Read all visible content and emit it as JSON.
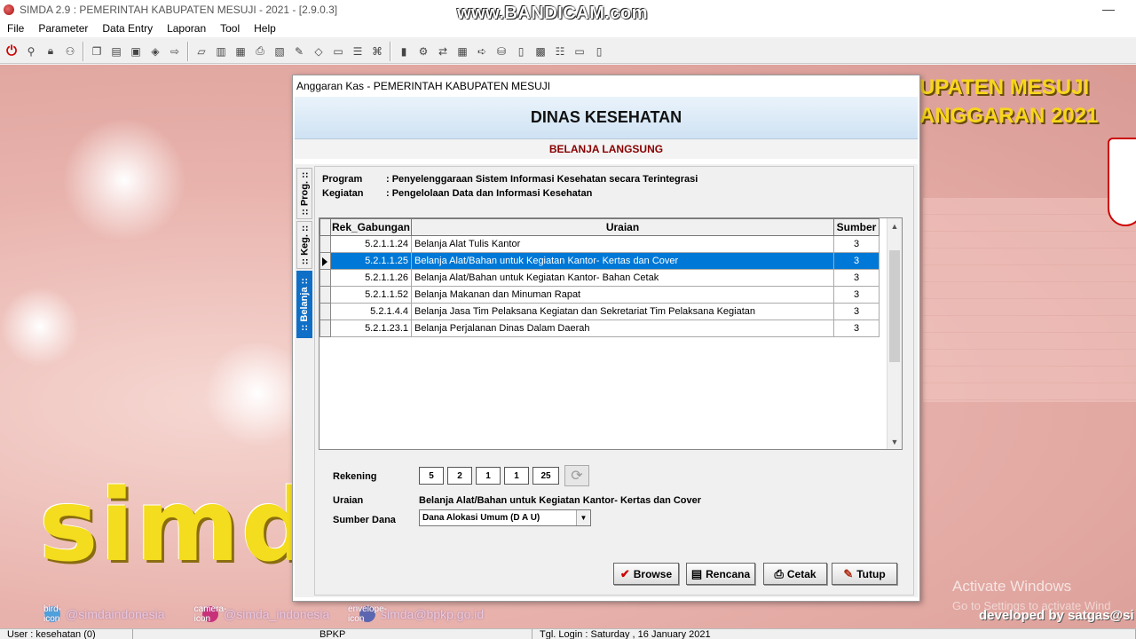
{
  "app": {
    "title": "SIMDA 2.9 : PEMERINTAH KABUPATEN MESUJI - 2021 - [2.9.0.3]",
    "watermark": "www.BANDICAM.com",
    "minimize": "—"
  },
  "menu": [
    "File",
    "Parameter",
    "Data Entry",
    "Laporan",
    "Tool",
    "Help"
  ],
  "desktop": {
    "banner_line1": "UPATEN MESUJI",
    "banner_line2": "ANGGARAN 2021",
    "logo_text": "simd",
    "twitter": "@simdaindonesia",
    "instagram": "@simda_indonesia",
    "email": "simda@bpkp.go.id",
    "activate_title": "Activate Windows",
    "activate_sub": "Go to Settings to activate Wind",
    "developed_by": "developed by satgas@si",
    "twitter_icon": "bird-icon",
    "instagram_icon": "camera-icon",
    "email_icon": "envelope-icon"
  },
  "statusbar": {
    "user": "User : kesehatan (0)",
    "org": "BPKP",
    "login": "Tgl. Login : Saturday , 16 January 2021"
  },
  "dialog": {
    "title": "Anggaran Kas - PEMERINTAH KABUPATEN MESUJI",
    "heading": "DINAS KESEHATAN",
    "subheading": "BELANJA LANGSUNG",
    "tabs": [
      {
        "label": ":: Prog. ::",
        "active": false
      },
      {
        "label": ":: Keg. ::",
        "active": false
      },
      {
        "label": ":: Belanja ::",
        "active": true
      }
    ],
    "program_label": "Program",
    "program_value": ": Penyelenggaraan Sistem Informasi Kesehatan secara Terintegrasi",
    "kegiatan_label": "Kegiatan",
    "kegiatan_value": ": Pengelolaan Data dan Informasi Kesehatan",
    "grid": {
      "columns": [
        "Rek_Gabungan",
        "Uraian",
        "Sumber"
      ],
      "rows": [
        {
          "rek": "5.2.1.1.24",
          "uraian": "Belanja Alat Tulis Kantor",
          "sumber": "3",
          "selected": false
        },
        {
          "rek": "5.2.1.1.25",
          "uraian": "Belanja Alat/Bahan untuk Kegiatan Kantor- Kertas dan Cover",
          "sumber": "3",
          "selected": true
        },
        {
          "rek": "5.2.1.1.26",
          "uraian": "Belanja Alat/Bahan untuk Kegiatan Kantor- Bahan Cetak",
          "sumber": "3",
          "selected": false
        },
        {
          "rek": "5.2.1.1.52",
          "uraian": "Belanja Makanan dan Minuman Rapat",
          "sumber": "3",
          "selected": false
        },
        {
          "rek": "5.2.1.4.4",
          "uraian": "Belanja Jasa Tim Pelaksana Kegiatan dan Sekretariat Tim Pelaksana Kegiatan",
          "sumber": "3",
          "selected": false
        },
        {
          "rek": "5.2.1.23.1",
          "uraian": "Belanja Perjalanan Dinas Dalam Daerah",
          "sumber": "3",
          "selected": false
        }
      ]
    },
    "form": {
      "rekening_label": "Rekening",
      "rekening_parts": [
        "5",
        "2",
        "1",
        "1",
        "25"
      ],
      "uraian_label": "Uraian",
      "uraian_value": "Belanja Alat/Bahan untuk Kegiatan Kantor- Kertas dan Cover",
      "sumber_label": "Sumber Dana",
      "sumber_value": "Dana Alokasi Umum (D A U)"
    },
    "buttons": {
      "browse": "Browse",
      "rencana": "Rencana",
      "cetak": "Cetak",
      "tutup": "Tutup"
    },
    "accent_color": "#0078d7"
  }
}
